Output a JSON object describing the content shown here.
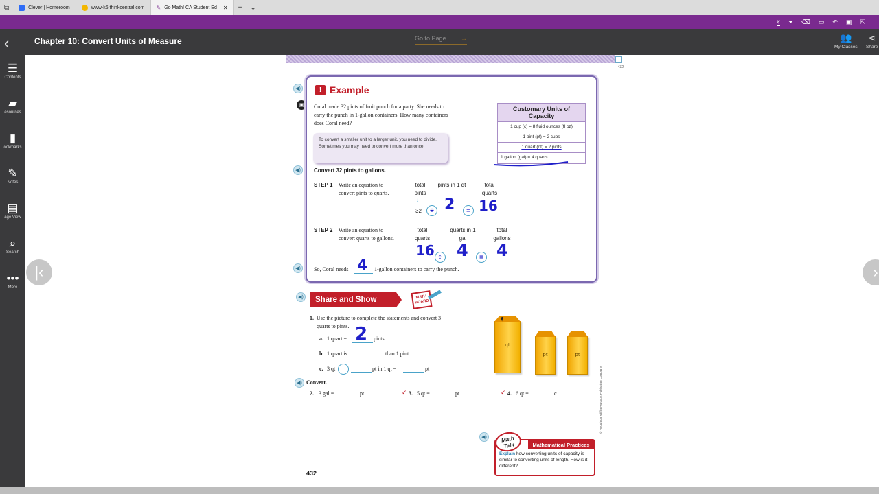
{
  "browser": {
    "tabs": [
      {
        "title": "Clever | Homeroom",
        "color": "#2e6cf6"
      },
      {
        "title": "www-k6.thinkcentral.com",
        "color": "#f3b700"
      },
      {
        "title": "Go Math! CA Student Ed",
        "color": "#7a2a8f"
      }
    ],
    "new_tab_symbol": "+",
    "tab_menu_symbol": "⌄",
    "close_symbol": "✕"
  },
  "header": {
    "chapter_title": "Chapter 10: Convert Units of Measure",
    "goto_label": "Go to Page",
    "goto_arrow": "→",
    "my_classes": "My Classes",
    "share": "Share"
  },
  "sidebar": {
    "items": [
      {
        "label": "Contents",
        "icon": "list-icon"
      },
      {
        "label": "esources",
        "icon": "folder-plus-icon"
      },
      {
        "label": "ookmarks",
        "icon": "bookmark-icon"
      },
      {
        "label": "Notes",
        "icon": "pencil-icon"
      },
      {
        "label": "age View",
        "icon": "page-view-icon"
      },
      {
        "label": "Search",
        "icon": "search-icon"
      },
      {
        "label": "More",
        "icon": "more-icon"
      }
    ]
  },
  "page": {
    "top_page_number": "432",
    "example": {
      "title": "Example",
      "problem": "Coral made 32 pints of fruit punch for a party. She needs to carry the punch in 1-gallon containers. How many containers does Coral need?",
      "hint": "To convert a smaller unit to a larger unit, you need to divide. Sometimes you may need to convert more than once.",
      "table_title": "Customary Units of Capacity",
      "table_rows": [
        "1 cup (c) = 8 fluid ounces (fl oz)",
        "1 pint (pt) = 2 cups",
        "1 quart (qt) = 2 pints",
        "1 gallon (gal) = 4 quarts"
      ],
      "convert_line": "Convert 32 pints to gallons.",
      "step1_label": "STEP 1",
      "step1_text": "Write an equation to convert pints to quarts.",
      "step1_cols": [
        "total pints",
        "pints in 1 qt",
        "total quarts"
      ],
      "step1_arrow": "↓",
      "step1_start": "32",
      "step1_op1": "÷",
      "step1_value": "2",
      "step1_op2": "=",
      "step1_result": "16",
      "step2_label": "STEP 2",
      "step2_text": "Write an equation to convert quarts to gallons.",
      "step2_cols": [
        "total quarts",
        "quarts in 1 gal",
        "total gallons"
      ],
      "step2_start": "16",
      "step2_op1": "÷",
      "step2_value": "4",
      "step2_op2": "=",
      "step2_result": "4",
      "so_text": "So, Coral needs",
      "so_answer": "4",
      "so_after": "1-gallon containers to carry the punch."
    },
    "share_show": {
      "title": "Share and Show",
      "mathboard": "MATH BOARD",
      "q1_num": "1.",
      "q1_text": "Use the picture to complete the statements and convert 3 quarts to pints.",
      "q1a_label": "a.",
      "q1a_pre": "1 quart =",
      "q1a_answer": "2",
      "q1a_post": "pints",
      "q1b_label": "b.",
      "q1b_pre": "1 quart is",
      "q1b_post": "than 1 pint.",
      "q1c_label": "c.",
      "q1c_pre": "3 qt",
      "q1c_mid": "pt in 1 qt =",
      "q1c_post": "pt",
      "cartons": [
        "qt",
        "pt",
        "pt"
      ],
      "convert_label": "Convert.",
      "q2": {
        "num": "2.",
        "pre": "3 gal =",
        "unit": "pt"
      },
      "q3": {
        "num": "3.",
        "pre": "5 qt =",
        "unit": "pt"
      },
      "q4": {
        "num": "4.",
        "pre": "6 qt =",
        "unit": "c"
      },
      "check_symbol": "✓"
    },
    "math_talk": {
      "bubble": "Math Talk",
      "heading": "Mathematical Practices",
      "explain_word": "Explain",
      "text": "how converting units of capacity is similar to converting units of length. How is it different?"
    },
    "copyright": "© Houghton Mifflin Harcourt Publishing Company",
    "page_number": "432"
  },
  "nav": {
    "prev_symbol": "|‹",
    "next_symbol": "›"
  }
}
